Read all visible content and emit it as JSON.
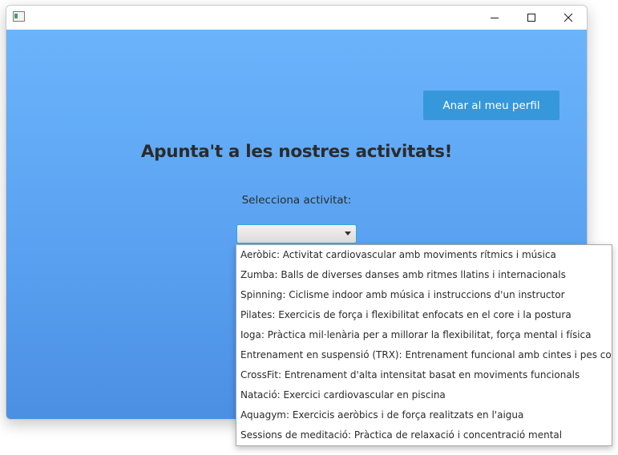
{
  "window": {
    "title": ""
  },
  "titlebar": {
    "icons": {
      "app": "app-window-icon",
      "minimize": "minimize-icon",
      "maximize": "maximize-icon",
      "close": "close-icon"
    }
  },
  "main": {
    "profile_button_label": "Anar al meu perfil",
    "heading": "Apunta't a les nostres activitats!",
    "select_label": "Selecciona activitat:",
    "combo_value": "",
    "combo_icon": "chevron-down-icon"
  },
  "dropdown": {
    "options": [
      "Aeròbic: Activitat cardiovascular amb moviments rítmics i música",
      "Zumba: Balls de diverses danses amb ritmes llatins i internacionals",
      "Spinning: Ciclisme indoor amb música i instruccions d'un instructor",
      "Pilates: Exercicis de força i flexibilitat enfocats en el core i la postura",
      "Ioga: Pràctica mil·lenària per a millorar la flexibilitat, força mental i física",
      "Entrenament en suspensió (TRX): Entrenament funcional amb cintes i pes corporal",
      "CrossFit: Entrenament d'alta intensitat basat en moviments funcionals",
      "Natació: Exercici cardiovascular en piscina",
      "Aquagym: Exercicis aeròbics i de força realitzats en l'aigua",
      "Sessions de meditació: Pràctica de relaxació i concentració mental"
    ]
  },
  "colors": {
    "gradient_top": "#6bb4fb",
    "gradient_bottom": "#4b8fe3",
    "button_bg": "#3797db",
    "button_text": "#ffffff",
    "heading_text": "#2b2b2b"
  }
}
